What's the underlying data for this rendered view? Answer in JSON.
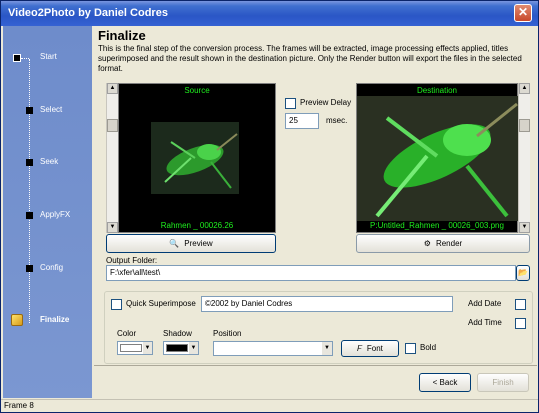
{
  "window": {
    "title": "Video2Photo by Daniel Codres",
    "close": "✕"
  },
  "sidebar": {
    "steps": [
      {
        "label": "Start"
      },
      {
        "label": "Select"
      },
      {
        "label": "Seek"
      },
      {
        "label": "ApplyFX"
      },
      {
        "label": "Config"
      },
      {
        "label": "Finalize",
        "active": true
      }
    ]
  },
  "page": {
    "title": "Finalize",
    "description": "This is the final step of the conversion process. The frames will be extracted, image processing effects applied, titles superimposed and the result shown in the destination picture. Only the Render button will export the files in the selected format."
  },
  "source": {
    "caption": "Source",
    "filename": "Rahmen _ 00026.26"
  },
  "destination": {
    "caption": "Destination",
    "filename": "P:Untitled_Rahmen _ 00026_003.png"
  },
  "preview_delay": {
    "label": "Preview Delay",
    "value": "25",
    "unit": "msec."
  },
  "buttons": {
    "preview": "Preview",
    "render": "Render",
    "back": "< Back",
    "finish": "Finish",
    "font": "Font"
  },
  "output": {
    "label": "Output Folder:",
    "value": "F:\\xfer\\all\\test\\"
  },
  "options": {
    "quick_superimpose_label": "Quick Superimpose",
    "superimpose_text": "©2002 by Daniel Codres",
    "add_date_label": "Add Date",
    "add_time_label": "Add Time",
    "color_label": "Color",
    "shadow_label": "Shadow",
    "position_label": "Position",
    "position_value": "",
    "bold_label": "Bold",
    "color_value": "#ffffff",
    "shadow_value": "#000000"
  },
  "statusbar": {
    "text": "Frame 8"
  }
}
